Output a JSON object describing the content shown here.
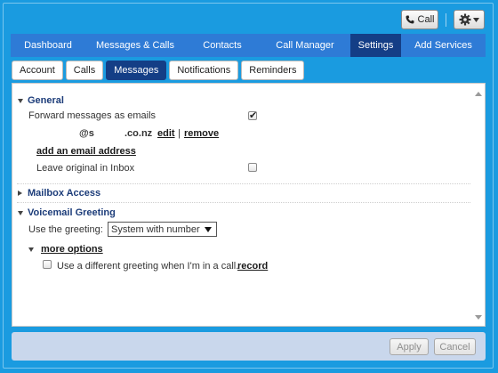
{
  "toolbar": {
    "call_label": "Call",
    "call_icon": "phone-icon",
    "settings_icon": "gear-icon"
  },
  "main_tabs": [
    {
      "label": "Dashboard",
      "active": false
    },
    {
      "label": "Messages & Calls",
      "active": false
    },
    {
      "label": "Contacts",
      "active": false
    },
    {
      "label": "Call Manager",
      "active": false
    },
    {
      "label": "Settings",
      "active": true
    },
    {
      "label": "Add Services",
      "active": false
    }
  ],
  "sub_tabs": [
    {
      "label": "Account",
      "active": false
    },
    {
      "label": "Calls",
      "active": false
    },
    {
      "label": "Messages",
      "active": true
    },
    {
      "label": "Notifications",
      "active": false
    },
    {
      "label": "Reminders",
      "active": false
    }
  ],
  "general": {
    "title": "General",
    "forward_label": "Forward messages as emails",
    "forward_checked": true,
    "email_part1": "@s",
    "email_part2": ".co.nz",
    "edit_link": "edit",
    "link_separator": "|",
    "remove_link": "remove",
    "add_email_link": "add an email address",
    "leave_original_label": "Leave original in Inbox",
    "leave_original_checked": false
  },
  "mailbox_access": {
    "title": "Mailbox Access"
  },
  "voicemail": {
    "title": "Voicemail Greeting",
    "use_greeting_label": "Use the greeting:",
    "greeting_value": "System with number",
    "more_options_link": "more options",
    "different_greeting_label": "Use a different greeting when I'm in a call.",
    "different_greeting_checked": false,
    "record_link": "record"
  },
  "footer": {
    "apply_label": "Apply",
    "cancel_label": "Cancel"
  },
  "colors": {
    "background": "#1a9be0",
    "tab_bar": "#2e7bd6",
    "tab_active": "#143e86",
    "section_title": "#1d3d7a",
    "footer": "#c9d7ec"
  }
}
